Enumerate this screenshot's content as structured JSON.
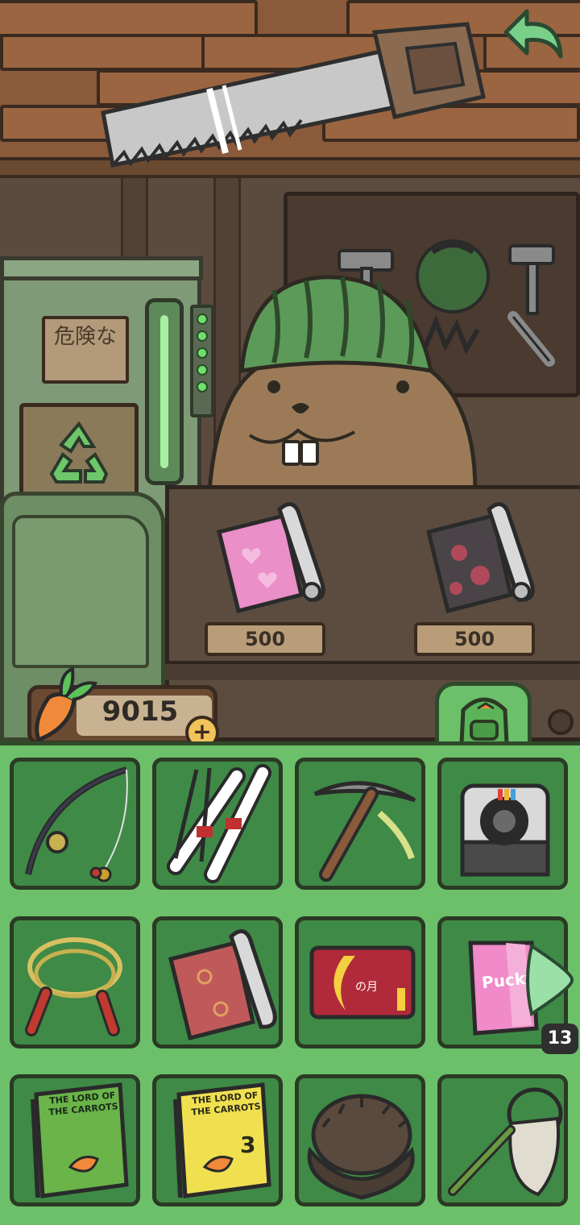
{
  "scene": {
    "danger_sign": "危険な",
    "shop_items": [
      {
        "name": "pink-heart-wallpaper",
        "price": "500"
      },
      {
        "name": "sakura-wallpaper",
        "price": "500"
      }
    ]
  },
  "currency": {
    "carrots": "9015",
    "plus_label": "+"
  },
  "inventory": {
    "items": [
      {
        "name": "fishing-rod"
      },
      {
        "name": "skis-and-poles"
      },
      {
        "name": "pickaxe"
      },
      {
        "name": "instant-camera"
      },
      {
        "name": "jump-rope"
      },
      {
        "name": "red-wallpaper-roll"
      },
      {
        "name": "moon-card",
        "text": "の月"
      },
      {
        "name": "pocky-box",
        "text": "Pucky"
      },
      {
        "name": "lord-of-the-carrots-book",
        "text": "THE LORD OF THE CARROTS"
      },
      {
        "name": "lord-of-the-carrots-book-3",
        "text": "THE LORD OF THE CARROTS",
        "number": "3"
      },
      {
        "name": "fur-hat"
      },
      {
        "name": "bug-net"
      }
    ],
    "page_count": "13"
  }
}
